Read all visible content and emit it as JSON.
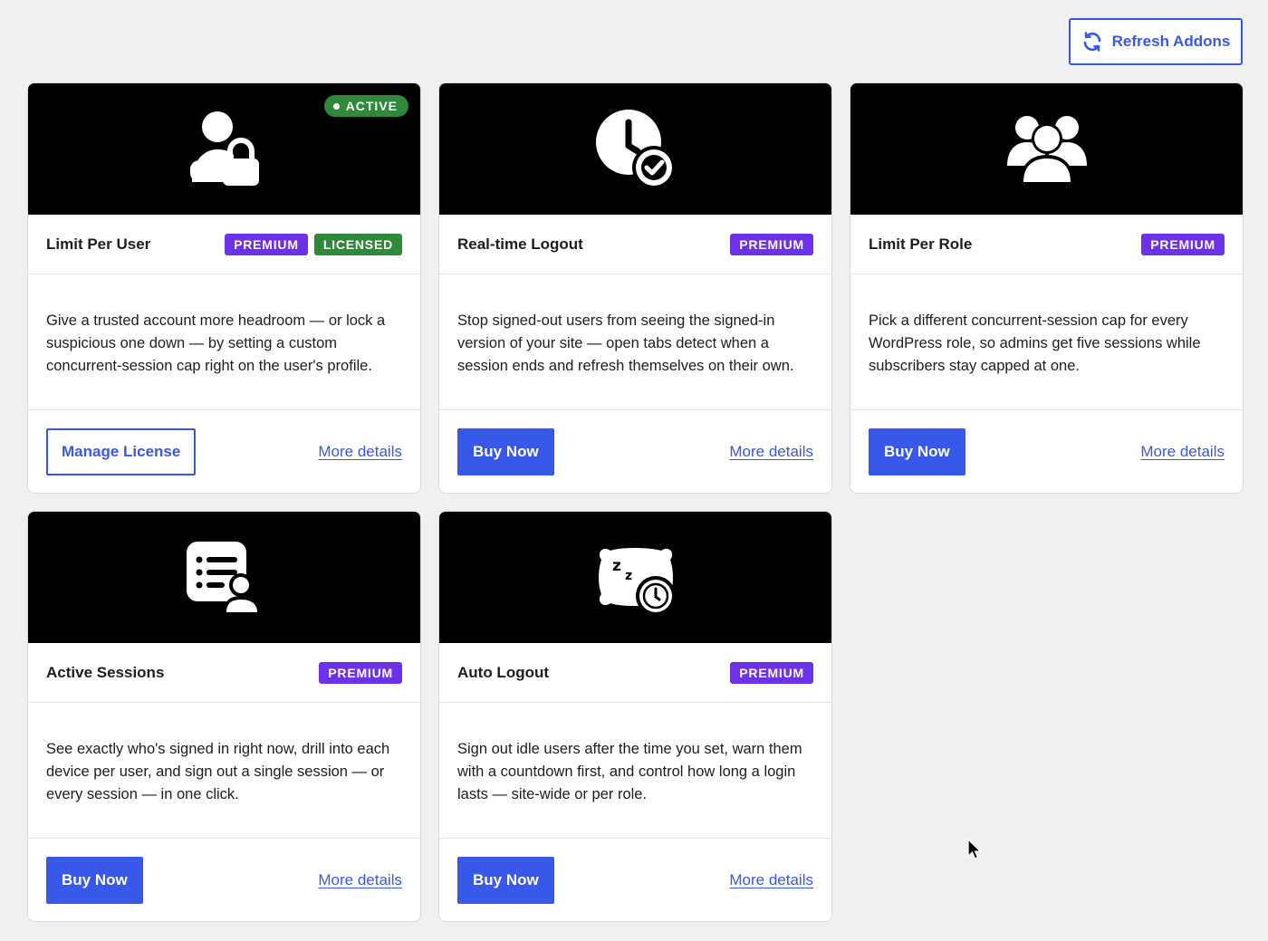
{
  "header": {
    "refresh_label": "Refresh Addons",
    "refresh_icon": "refresh-icon",
    "accent_color": "#3858e9"
  },
  "cards": [
    {
      "title": "Limit Per User",
      "icon": "user-lock-icon",
      "active_badge": "ACTIVE",
      "tags": [
        "PREMIUM",
        "LICENSED"
      ],
      "description": "Give a trusted account more headroom — or lock a suspicious one down — by setting a custom concurrent-session cap right on the user's profile.",
      "primary_button": "Manage License",
      "link": "More details"
    },
    {
      "title": "Real-time Logout",
      "icon": "clock-check-icon",
      "tags": [
        "PREMIUM"
      ],
      "description": "Stop signed-out users from seeing the signed-in version of your site — open tabs detect when a session ends and refresh themselves on their own.",
      "primary_button": "Buy Now",
      "link": "More details"
    },
    {
      "title": "Limit Per Role",
      "icon": "users-group-icon",
      "tags": [
        "PREMIUM"
      ],
      "description": "Pick a different concurrent-session cap for every WordPress role, so admins get five sessions while subscribers stay capped at one.",
      "primary_button": "Buy Now",
      "link": "More details"
    },
    {
      "title": "Active Sessions",
      "icon": "session-list-icon",
      "tags": [
        "PREMIUM"
      ],
      "description": "See exactly who's signed in right now, drill into each device per user, and sign out a single session — or every session — in one click.",
      "primary_button": "Buy Now",
      "link": "More details"
    },
    {
      "title": "Auto Logout",
      "icon": "sleep-clock-icon",
      "tags": [
        "PREMIUM"
      ],
      "description": "Sign out idle users after the time you set, warn them with a countdown first, and control how long a login lasts — site-wide or per role.",
      "primary_button": "Buy Now",
      "link": "More details"
    }
  ],
  "colors": {
    "premium": "#6d32e8",
    "licensed": "#2e8a3a",
    "active": "#2e8a3a"
  }
}
